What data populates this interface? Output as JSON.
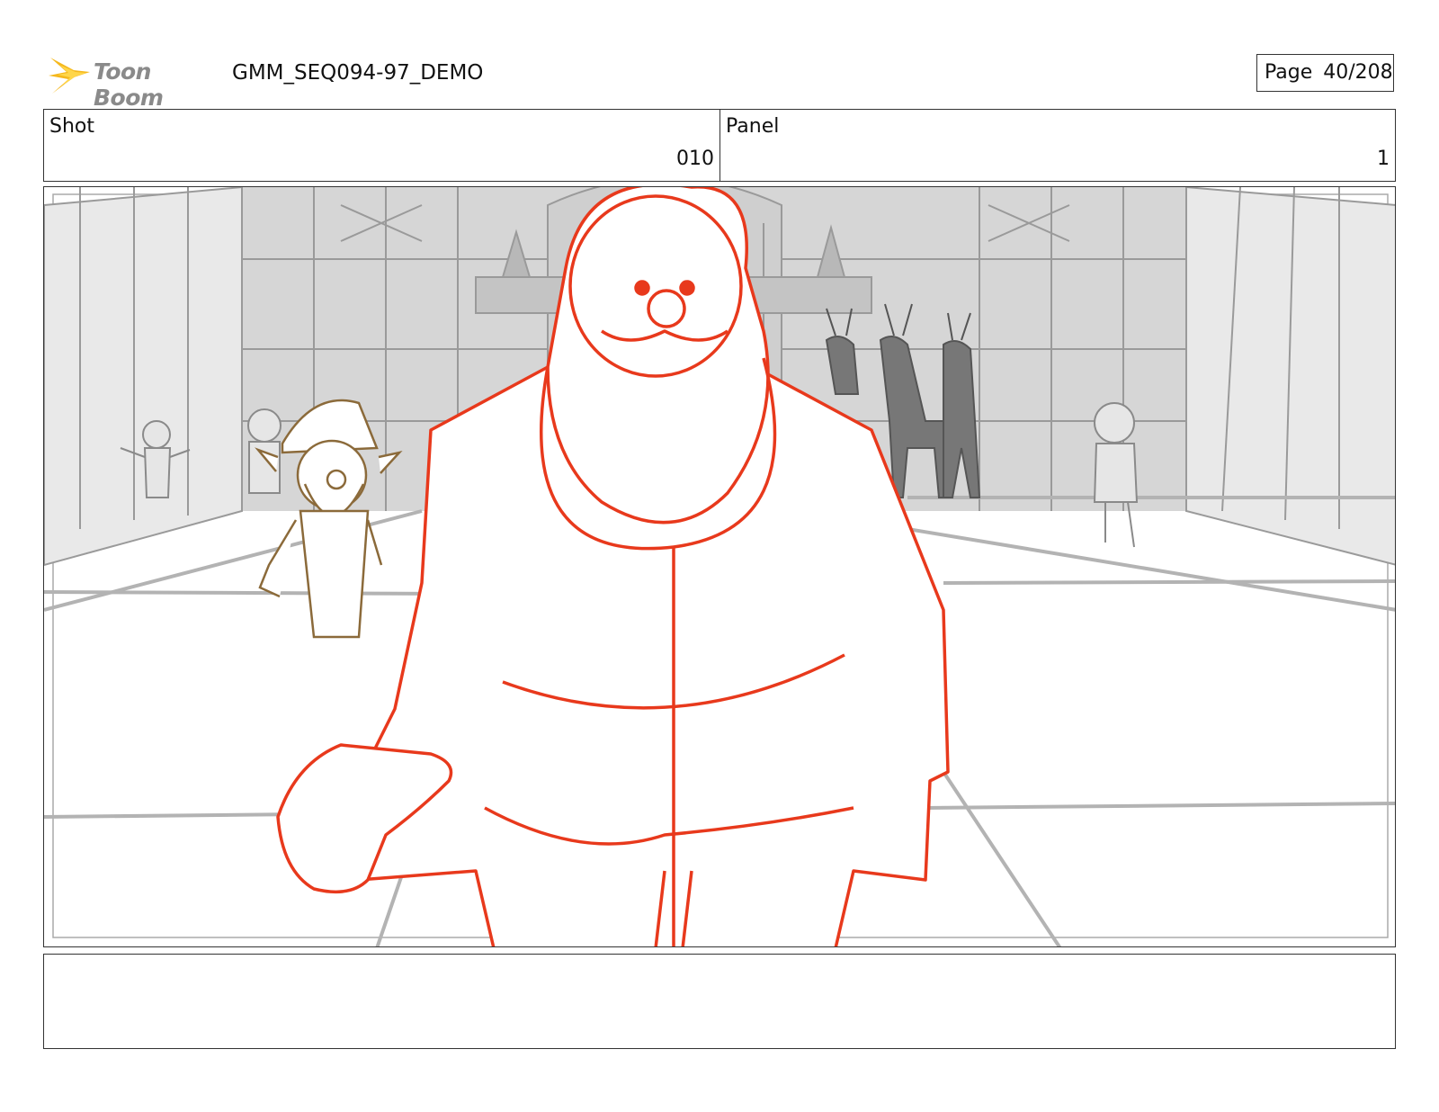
{
  "header": {
    "logo_text": "Toon Boom",
    "doc_title": "GMM_SEQ094-97_DEMO",
    "page_label": "Page",
    "page_value": "40/208"
  },
  "info": {
    "shot_label": "Shot",
    "shot_value": "010",
    "panel_label": "Panel",
    "panel_value": "1"
  },
  "colors": {
    "santa": "#e8391c",
    "elf": "#8b6a3a",
    "background_sketch": "#9a9a9a",
    "reindeer": "#555555"
  },
  "notes": {
    "text": ""
  }
}
